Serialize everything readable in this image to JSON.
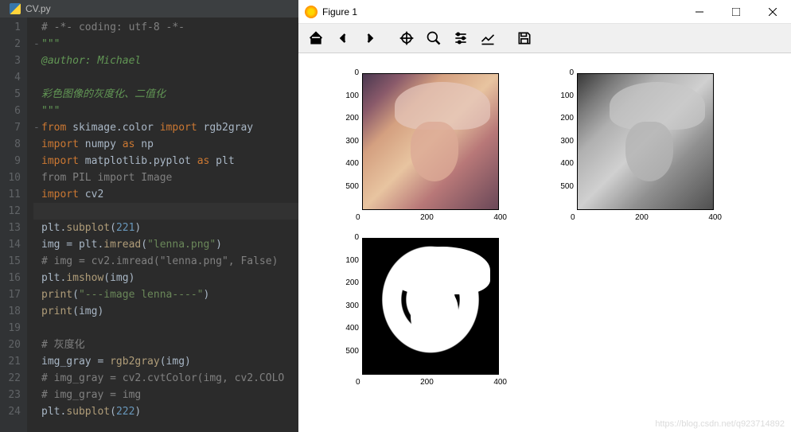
{
  "editor": {
    "tab_name": "CV.py",
    "lines": [
      {
        "n": 1,
        "segs": [
          {
            "t": "# -*- coding: utf-8 -*-",
            "c": "c-comment"
          }
        ]
      },
      {
        "n": 2,
        "fold": "-",
        "segs": [
          {
            "t": "\"\"\"",
            "c": "c-comment-it"
          }
        ]
      },
      {
        "n": 3,
        "segs": [
          {
            "t": "@author: Michael",
            "c": "c-comment-it"
          }
        ]
      },
      {
        "n": 4,
        "segs": []
      },
      {
        "n": 5,
        "segs": [
          {
            "t": "彩色图像的灰度化、二值化",
            "c": "c-comment-it"
          }
        ]
      },
      {
        "n": 6,
        "segs": [
          {
            "t": "\"\"\"",
            "c": "c-comment-it"
          }
        ]
      },
      {
        "n": 7,
        "fold": "-",
        "segs": [
          {
            "t": "from ",
            "c": "c-kw"
          },
          {
            "t": "skimage.color "
          },
          {
            "t": "import ",
            "c": "c-kw"
          },
          {
            "t": "rgb2gray"
          }
        ]
      },
      {
        "n": 8,
        "segs": [
          {
            "t": "import ",
            "c": "c-kw"
          },
          {
            "t": "numpy "
          },
          {
            "t": "as ",
            "c": "c-kw"
          },
          {
            "t": "np"
          }
        ]
      },
      {
        "n": 9,
        "segs": [
          {
            "t": "import ",
            "c": "c-kw"
          },
          {
            "t": "matplotlib.pyplot "
          },
          {
            "t": "as ",
            "c": "c-kw"
          },
          {
            "t": "plt"
          }
        ]
      },
      {
        "n": 10,
        "segs": [
          {
            "t": "from PIL import Image",
            "c": "c-comment"
          }
        ]
      },
      {
        "n": 11,
        "segs": [
          {
            "t": "import ",
            "c": "c-kw"
          },
          {
            "t": "cv2"
          }
        ]
      },
      {
        "n": 12,
        "hl": true,
        "segs": []
      },
      {
        "n": 13,
        "segs": [
          {
            "t": "plt."
          },
          {
            "t": "subplot",
            "c": "c-fn"
          },
          {
            "t": "("
          },
          {
            "t": "221",
            "c": "c-num"
          },
          {
            "t": ")"
          }
        ]
      },
      {
        "n": 14,
        "segs": [
          {
            "t": "img = plt."
          },
          {
            "t": "imread",
            "c": "c-fn"
          },
          {
            "t": "("
          },
          {
            "t": "\"lenna.png\"",
            "c": "c-str"
          },
          {
            "t": ")"
          }
        ]
      },
      {
        "n": 15,
        "segs": [
          {
            "t": "# img = cv2.imread(\"lenna.png\", False)",
            "c": "c-comment"
          }
        ]
      },
      {
        "n": 16,
        "segs": [
          {
            "t": "plt."
          },
          {
            "t": "imshow",
            "c": "c-fn"
          },
          {
            "t": "(img)"
          }
        ]
      },
      {
        "n": 17,
        "segs": [
          {
            "t": "print",
            "c": "c-fn"
          },
          {
            "t": "("
          },
          {
            "t": "\"---image lenna----\"",
            "c": "c-str"
          },
          {
            "t": ")"
          }
        ]
      },
      {
        "n": 18,
        "segs": [
          {
            "t": "print",
            "c": "c-fn"
          },
          {
            "t": "(img)"
          }
        ]
      },
      {
        "n": 19,
        "segs": []
      },
      {
        "n": 20,
        "segs": [
          {
            "t": "# 灰度化",
            "c": "c-comment"
          }
        ]
      },
      {
        "n": 21,
        "segs": [
          {
            "t": "img_gray = "
          },
          {
            "t": "rgb2gray",
            "c": "c-fn"
          },
          {
            "t": "(img)"
          }
        ]
      },
      {
        "n": 22,
        "segs": [
          {
            "t": "# img_gray = cv2.cvtColor(img, cv2.COLO",
            "c": "c-comment"
          }
        ]
      },
      {
        "n": 23,
        "segs": [
          {
            "t": "# img_gray = img",
            "c": "c-comment"
          }
        ]
      },
      {
        "n": 24,
        "segs": [
          {
            "t": "plt."
          },
          {
            "t": "subplot",
            "c": "c-fn"
          },
          {
            "t": "("
          },
          {
            "t": "222",
            "c": "c-num"
          },
          {
            "t": ")"
          }
        ]
      }
    ]
  },
  "figure": {
    "title": "Figure 1",
    "y_ticks": [
      "0",
      "100",
      "200",
      "300",
      "400",
      "500"
    ],
    "x_ticks": [
      "0",
      "200",
      "400"
    ],
    "watermark": "https://blog.csdn.net/q923714892"
  },
  "chart_data": [
    {
      "type": "heatmap",
      "title": "",
      "xlabel": "",
      "ylabel": "",
      "xlim": [
        0,
        500
      ],
      "ylim": [
        500,
        0
      ],
      "description": "color image (lenna)"
    },
    {
      "type": "heatmap",
      "title": "",
      "xlabel": "",
      "ylabel": "",
      "xlim": [
        0,
        500
      ],
      "ylim": [
        500,
        0
      ],
      "description": "grayscale image"
    },
    {
      "type": "heatmap",
      "title": "",
      "xlabel": "",
      "ylabel": "",
      "xlim": [
        0,
        500
      ],
      "ylim": [
        500,
        0
      ],
      "description": "binary threshold image"
    }
  ]
}
